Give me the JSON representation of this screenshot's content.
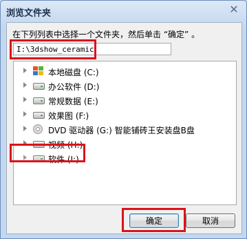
{
  "window": {
    "title": "浏览文件夹",
    "close_glyph": "✕"
  },
  "instruction": "在下列列表中选择一个文件夹，然后单击 “确定” 。",
  "path_field": {
    "value": "I:\\3dshow_ceramic"
  },
  "tree": {
    "items": [
      {
        "label": "本地磁盘 (C:)",
        "icon": "windows-drive-icon"
      },
      {
        "label": "办公软件 (D:)",
        "icon": "drive-icon"
      },
      {
        "label": "常规数据 (E:)",
        "icon": "drive-icon"
      },
      {
        "label": "效果图 (F:)",
        "icon": "drive-icon"
      },
      {
        "label": "DVD 驱动器 (G:) 智能铺砖王安装盘B盘",
        "icon": "dvd-icon"
      },
      {
        "label": "视频 (H:)",
        "icon": "drive-icon"
      },
      {
        "label": "软件 (I:)",
        "icon": "drive-icon"
      }
    ]
  },
  "buttons": {
    "ok": "确定",
    "cancel": "取消"
  },
  "colors": {
    "highlight": "#d9141b",
    "title_text": "#1d2f4e"
  }
}
